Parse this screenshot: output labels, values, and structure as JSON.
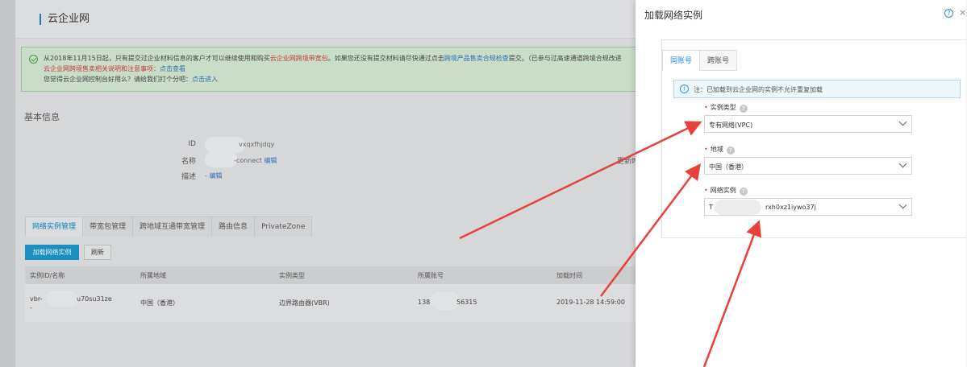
{
  "app": {
    "title": "云企业网"
  },
  "notice": {
    "line1_a": "从2018年11月15日起，只有提交过企业材料信息的客户才可以继续使用和购买",
    "line1_red": "云企业网跨境带宽包",
    "line1_b": "。如果您还没有提交材料请尽快通过点击",
    "line1_link": "跨境产品售卖合规检查",
    "line1_c": "提交。（已参与过高速通道跨境合规改进",
    "line2_red": "云企业网跨境售卖相关说明和注意事项：",
    "line2_link": "点击查看",
    "line3": "您觉得云企业网控制台好用么？请给我们打个分吧：",
    "line3_link": "点击进入"
  },
  "basic_info": {
    "title": "基本信息",
    "id_label": "ID",
    "id_value": "vxqxfhjdqy",
    "name_label": "名称",
    "name_value": "-connect",
    "name_edit": "编辑",
    "desc_label": "描述",
    "desc_value": "-",
    "desc_edit": "编辑",
    "right_truncated": "更新时"
  },
  "tabs": [
    "网络实例管理",
    "带宽包管理",
    "跨地域互通带宽管理",
    "路由信息",
    "PrivateZone"
  ],
  "buttons": {
    "load": "加载网络实例",
    "refresh": "刷新"
  },
  "table": {
    "headers": [
      "实例ID/名称",
      "所属地域",
      "实例类型",
      "所属账号",
      "加载时间"
    ],
    "rows": [
      {
        "id_prefix": "vbr-",
        "id_suffix": "u70su31ze",
        "name": "-",
        "region": "中国（香港）",
        "type": "边界路由器(VBR)",
        "account_prefix": "138",
        "account_suffix": "56315",
        "time": "2019-11-28 14:59:00"
      }
    ]
  },
  "drawer": {
    "title": "加载网络实例",
    "help": "?",
    "close": "×",
    "tabs": [
      "同账号",
      "跨账号"
    ],
    "tip": "注：已加载到云企业网的实例不允许重复加载",
    "tip_icon": "i",
    "fields": [
      {
        "label": "实例类型",
        "value": "专有网络(VPC)"
      },
      {
        "label": "地域",
        "value": "中国（香港）"
      },
      {
        "label": "网络实例",
        "value_prefix": "T",
        "value": "rxh0xz1iywo37j"
      }
    ]
  },
  "colors": {
    "accent": "#1f8ad0",
    "primary_button": "#1b8fc2",
    "required_star": "#e0413a",
    "annotation_arrow": "#e8403a"
  }
}
